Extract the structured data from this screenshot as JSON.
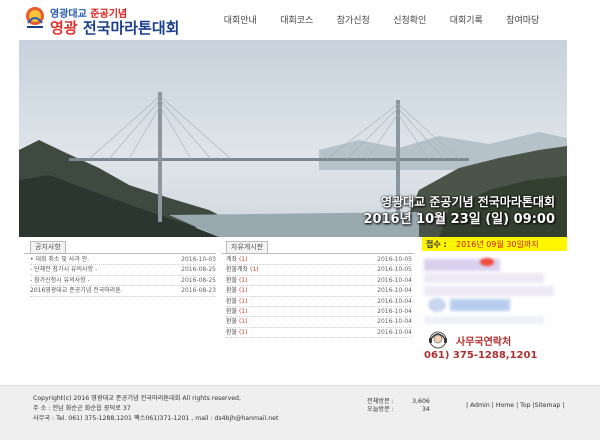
{
  "logo": {
    "line1_a": "영광대교",
    "line1_b": "준공기념",
    "line2_a": "영광",
    "line2_b": "전국마라톤대회"
  },
  "nav": [
    "대회안내",
    "대회코스",
    "참가신청",
    "신청확인",
    "대회기록",
    "참여마당"
  ],
  "hero": {
    "title": "영광대교 준공기념 전국마라톤대회",
    "date": "2016년 10월 23일 (일) 09:00"
  },
  "notice": {
    "tab": "공지사항",
    "items": [
      {
        "title": "• 대회 취소 및 사과 안.",
        "date": "2016-10-03"
      },
      {
        "title": "- 단체전 참가시 유의사항 -",
        "date": "2016-08-25"
      },
      {
        "title": "- 참가신청시 유의사항 -",
        "date": "2016-08-25"
      },
      {
        "title": "2016영광대교 준공기념 전국마라톤.",
        "date": "2016-08-23"
      }
    ]
  },
  "board": {
    "tab": "자유게시판",
    "items": [
      {
        "title": "계좌",
        "count": "(1)",
        "date": "2016-10-05"
      },
      {
        "title": "환불계좌",
        "count": "(1)",
        "date": "2016-10-05"
      },
      {
        "title": "환불",
        "count": "(1)",
        "date": "2016-10-04"
      },
      {
        "title": "환불",
        "count": "(1)",
        "date": "2016-10-04"
      },
      {
        "title": "환불",
        "count": "(1)",
        "date": "2016-10-04"
      },
      {
        "title": "환불",
        "count": "(1)",
        "date": "2016-10-04"
      },
      {
        "title": "환불",
        "count": "(1)",
        "date": "2016-10-04"
      },
      {
        "title": "환불",
        "count": "(1)",
        "date": "2016-10-04"
      }
    ]
  },
  "reception": {
    "label": "접수 :",
    "value": "2016년 09월 30일까지"
  },
  "contact": {
    "title": "사무국연락처",
    "phone": "061) 375-1288,1201"
  },
  "footer": {
    "line1": "Copyright(c) 2016 영광대교 준공기념 전국마라톤대회 All rights reserved,",
    "line2": "주 소 : 전남 화순군 화순읍 광덕로 37",
    "line3": "사무국 : Tel. 061) 375-1288,1201 팩스061)371-1201 , mail : ds4bjh@hanmail.net",
    "visits": [
      {
        "label": "전체방문 :",
        "value": "3,606"
      },
      {
        "label": "오늘방문 :",
        "value": "34"
      }
    ],
    "links": [
      "Admin",
      "Home",
      "Top",
      "Sitemap"
    ]
  },
  "colors": {
    "reception_bg": "#fff600",
    "accent_red": "#d0201a",
    "logo_blue": "#1a3e8a"
  }
}
